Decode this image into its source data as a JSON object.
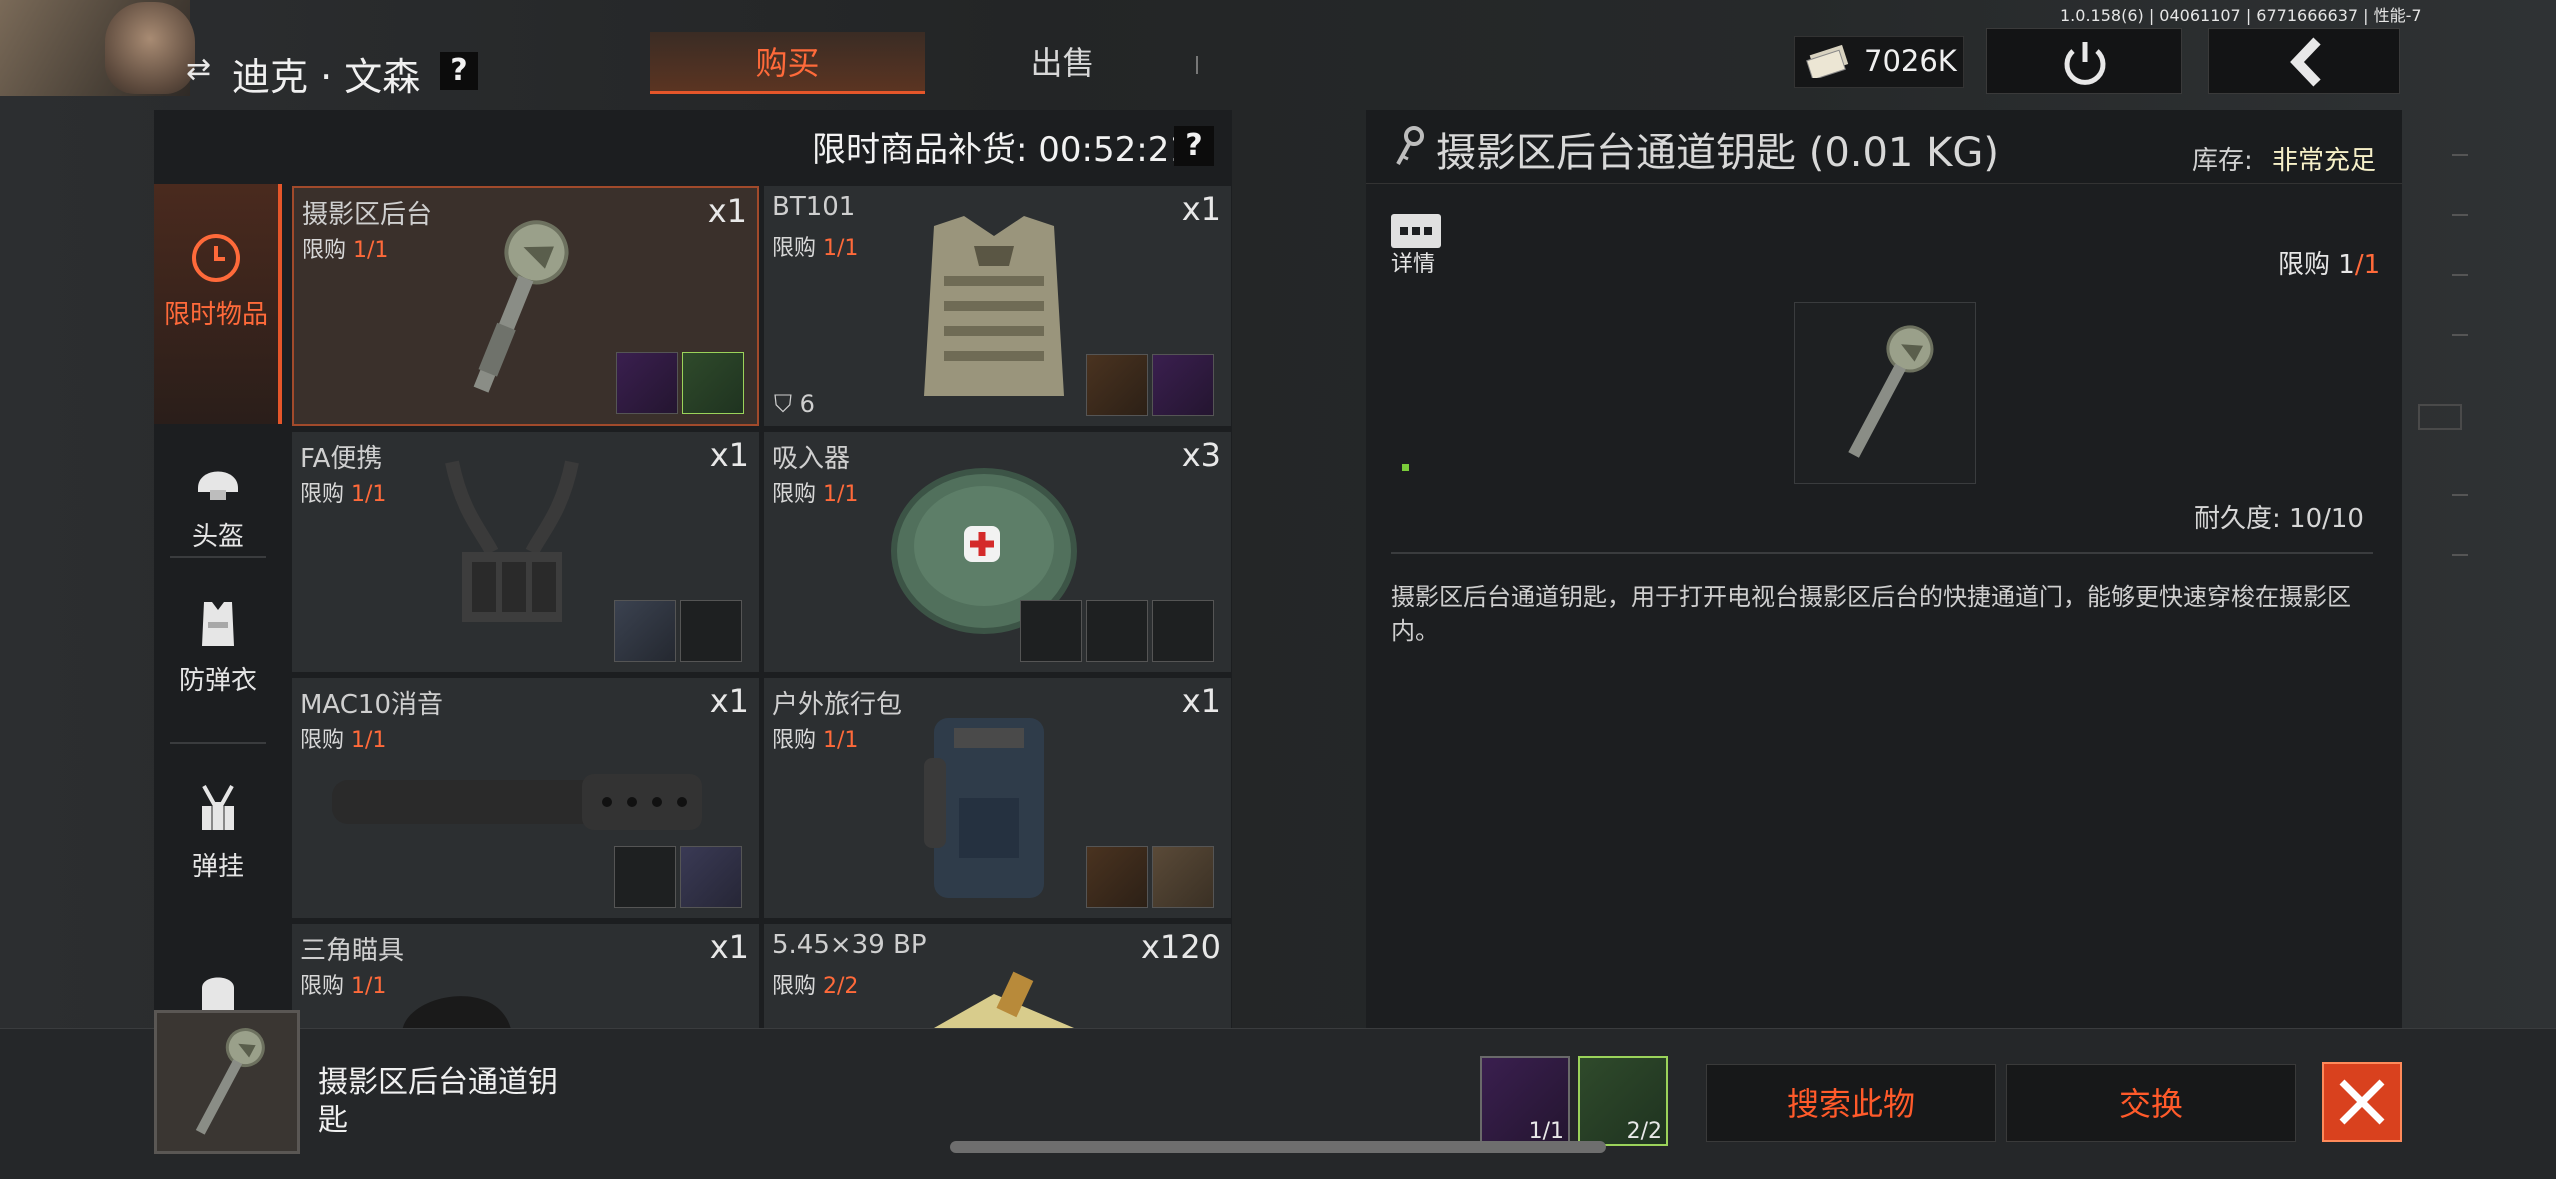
{
  "header": {
    "character_name": "迪克 · 文森",
    "help_mark": "?",
    "tabs": [
      {
        "label": "购买",
        "active": true
      },
      {
        "label": "出售",
        "active": false
      }
    ],
    "version_info": "1.0.158(6) | 04061107 | 6771666637 | 性能-7",
    "money": "7026K"
  },
  "shop": {
    "restock_label": "限时商品补货: 00:52:21",
    "help_mark": "?",
    "categories": [
      {
        "label": "限时物品",
        "icon": "clock-icon",
        "active": true
      },
      {
        "label": "头盔",
        "icon": "helmet-icon"
      },
      {
        "label": "防弹衣",
        "icon": "vest-icon"
      },
      {
        "label": "弹挂",
        "icon": "chest-rig-icon"
      }
    ],
    "items": [
      {
        "name": "摄影区后台",
        "limit_prefix": "限购 ",
        "limit": "1/1",
        "qty": "x1"
      },
      {
        "name": "BT101",
        "limit_prefix": "限购 ",
        "limit": "1/1",
        "qty": "x1",
        "armor_level": "6"
      },
      {
        "name": "FA便携",
        "limit_prefix": "限购 ",
        "limit": "1/1",
        "qty": "x1"
      },
      {
        "name": "吸入器",
        "limit_prefix": "限购 ",
        "limit": "1/1",
        "qty": "x3"
      },
      {
        "name": "MAC10消音",
        "limit_prefix": "限购 ",
        "limit": "1/1",
        "qty": "x1"
      },
      {
        "name": "户外旅行包",
        "limit_prefix": "限购 ",
        "limit": "1/1",
        "qty": "x1"
      },
      {
        "name": "三角瞄具",
        "limit_prefix": "限购 ",
        "limit": "1/1",
        "qty": "x1"
      },
      {
        "name": "5.45×39 BP",
        "limit_prefix": "限购 ",
        "limit": "2/2",
        "qty": "x120"
      }
    ]
  },
  "detail": {
    "title": "摄影区后台通道钥匙 (0.01 KG)",
    "stock_label": "库存:",
    "stock_value": "非常充足",
    "details_label": "详情",
    "limit_prefix": "限购 ",
    "limit_current": "1",
    "limit_total": "/1",
    "durability": "耐久度: 10/10",
    "description": "摄影区后台通道钥匙，用于打开电视台摄影区后台的快捷通道门，能够更快速穿梭在摄影区内。"
  },
  "bottom": {
    "item_name": "摄影区后台通道钥匙",
    "requirements": [
      {
        "count": "1/1"
      },
      {
        "count": "2/2"
      }
    ],
    "search_label": "搜索此物",
    "exchange_label": "交换"
  },
  "colors": {
    "accent": "#e5562a",
    "limit_orange": "#ff6a3a",
    "stock_yellow": "#f7f0c8",
    "close_red": "#d9411e"
  }
}
